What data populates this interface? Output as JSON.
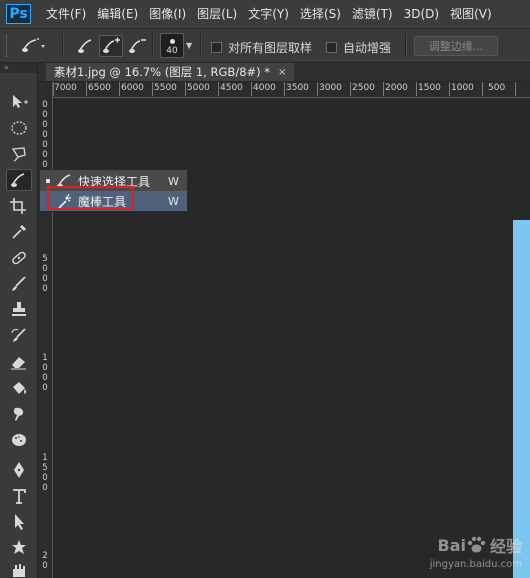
{
  "app": {
    "logo_text": "Ps"
  },
  "menubar": {
    "items": [
      "文件(F)",
      "编辑(E)",
      "图像(I)",
      "图层(L)",
      "文字(Y)",
      "选择(S)",
      "滤镜(T)",
      "3D(D)",
      "视图(V)"
    ]
  },
  "options_bar": {
    "brush_size": "40",
    "sample_all_layers_label": "对所有图层取样",
    "auto_enhance_label": "自动增强",
    "refine_edge_label": "调整边缘..."
  },
  "document": {
    "tab_title": "素材1.jpg @ 16.7% (图层 1, RGB/8#) *",
    "tab_close": "×"
  },
  "ruler_top": {
    "labels": [
      "7000",
      "6500",
      "6000",
      "5500",
      "5000",
      "4500",
      "4000",
      "3500",
      "3000",
      "2500",
      "2000",
      "1500",
      "1000",
      "500"
    ]
  },
  "ruler_left": {
    "groups": [
      [
        "0",
        "0",
        "0",
        "0",
        "0",
        "0",
        "0",
        "0"
      ],
      [
        "5",
        "0",
        "0",
        "0"
      ],
      [
        "1",
        "0",
        "0",
        "0"
      ],
      [
        "1",
        "5",
        "0",
        "0"
      ],
      [
        "2",
        "0"
      ]
    ]
  },
  "flyout": {
    "items": [
      {
        "label": "快速选择工具",
        "shortcut": "W",
        "selected": true,
        "icon": "quick-selection-icon"
      },
      {
        "label": "魔棒工具",
        "shortcut": "W",
        "selected": false,
        "icon": "magic-wand-icon"
      }
    ]
  },
  "watermark": {
    "brand": "Bai",
    "brand2": "经验",
    "url": "jingyan.baidu.com"
  },
  "colors": {
    "accent_highlight": "#e01e26",
    "ps_blue": "#31a8ff",
    "canvas_image": "#7cc6f2"
  }
}
